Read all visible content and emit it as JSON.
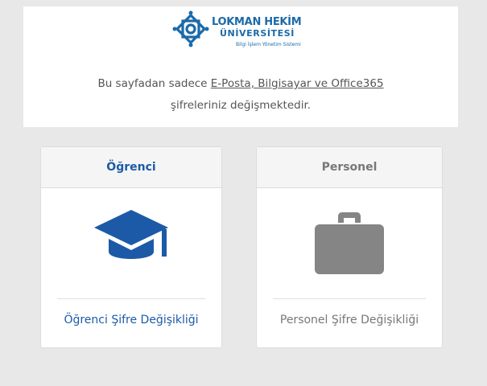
{
  "header": {
    "logo": {
      "name_line1": "LOKMAN HEKİM",
      "name_line2": "ÜNİVERSİTESİ",
      "subtitle": "Bilgi İşlem Yönetim Sistemi"
    },
    "info_prefix": "Bu sayfadan sadece ",
    "info_link": "E-Posta, Bilgisayar ve Office365",
    "info_suffix": "şifreleriniz değişmektedir."
  },
  "cards": {
    "student": {
      "title": "Öğrenci",
      "icon": "graduation-cap-icon",
      "link_label": "Öğrenci Şifre Değişikliği"
    },
    "staff": {
      "title": "Personel",
      "icon": "briefcase-icon",
      "link_label": "Personel Şifre Değişikliği"
    }
  },
  "colors": {
    "brand_blue": "#1c5aa8",
    "logo_blue": "#1c6aa8",
    "muted_gray": "#777777",
    "icon_gray": "#858585",
    "page_background": "#e8e8e8"
  }
}
